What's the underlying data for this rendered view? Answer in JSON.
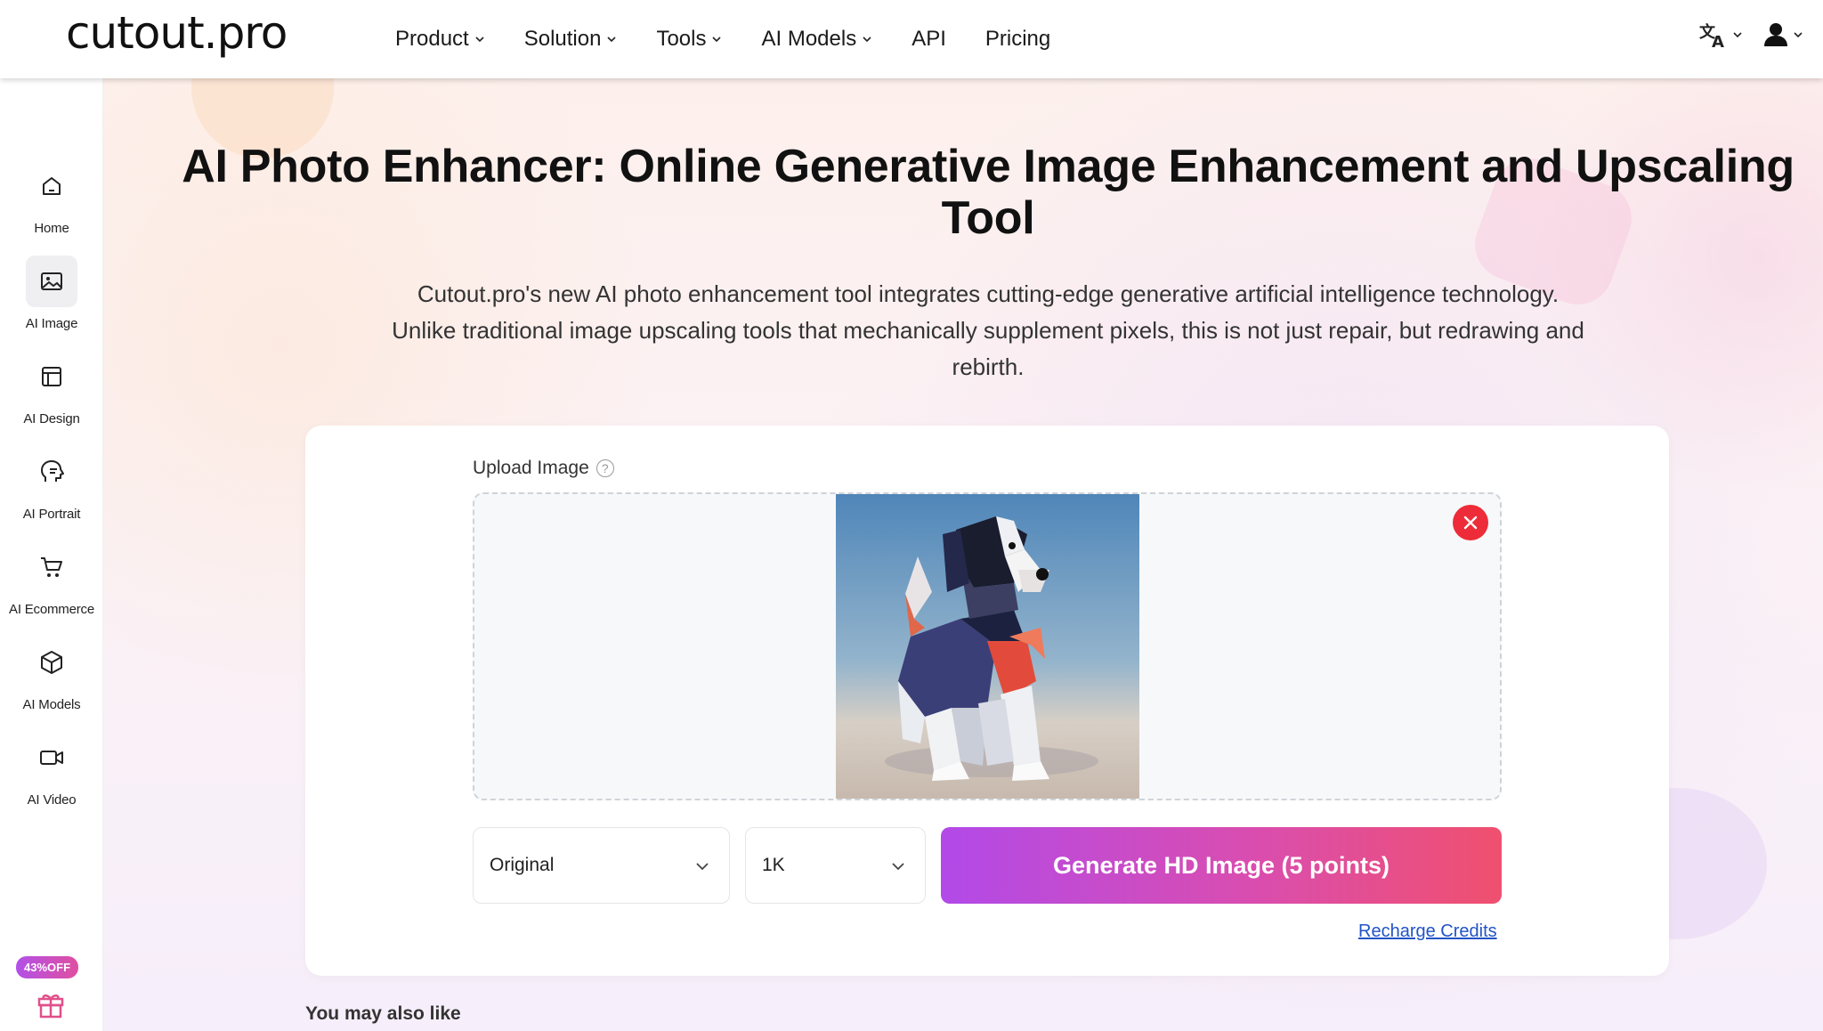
{
  "header": {
    "logo": "cutout.pro",
    "nav": [
      {
        "label": "Product",
        "dropdown": true
      },
      {
        "label": "Solution",
        "dropdown": true
      },
      {
        "label": "Tools",
        "dropdown": true
      },
      {
        "label": "AI Models",
        "dropdown": true
      },
      {
        "label": "API",
        "dropdown": false
      },
      {
        "label": "Pricing",
        "dropdown": false
      }
    ],
    "right_icons": [
      "translate-icon",
      "user-icon"
    ]
  },
  "sidebar": {
    "items": [
      {
        "label": "Home",
        "icon": "home-icon",
        "active": false
      },
      {
        "label": "AI Image",
        "icon": "image-icon",
        "active": true
      },
      {
        "label": "AI Design",
        "icon": "layout-icon",
        "active": false
      },
      {
        "label": "AI Portrait",
        "icon": "portrait-icon",
        "active": false
      },
      {
        "label": "AI Ecommerce",
        "icon": "cart-icon",
        "active": false
      },
      {
        "label": "AI Models",
        "icon": "cube-icon",
        "active": false
      },
      {
        "label": "AI Video",
        "icon": "video-icon",
        "active": false
      }
    ],
    "promo_badge": "43%OFF"
  },
  "main": {
    "title": "AI Photo Enhancer: Online Generative Image Enhancement and Upscaling Tool",
    "subtitle": "Cutout.pro's new AI photo enhancement tool integrates cutting-edge generative artificial intelligence technology. Unlike traditional image upscaling tools that mechanically supplement pixels, this is not just repair, but redrawing and rebirth.",
    "upload_label": "Upload Image",
    "help_glyph": "?",
    "mode_select": "Original",
    "resolution_select": "1K",
    "generate_button": "Generate HD Image (5 points)",
    "recharge_link": "Recharge Credits",
    "also_like": "You may also like"
  },
  "colors": {
    "accent_start": "#b24ae8",
    "accent_end": "#f0506e",
    "remove_red": "#ee2b38",
    "link_blue": "#2253c7"
  }
}
